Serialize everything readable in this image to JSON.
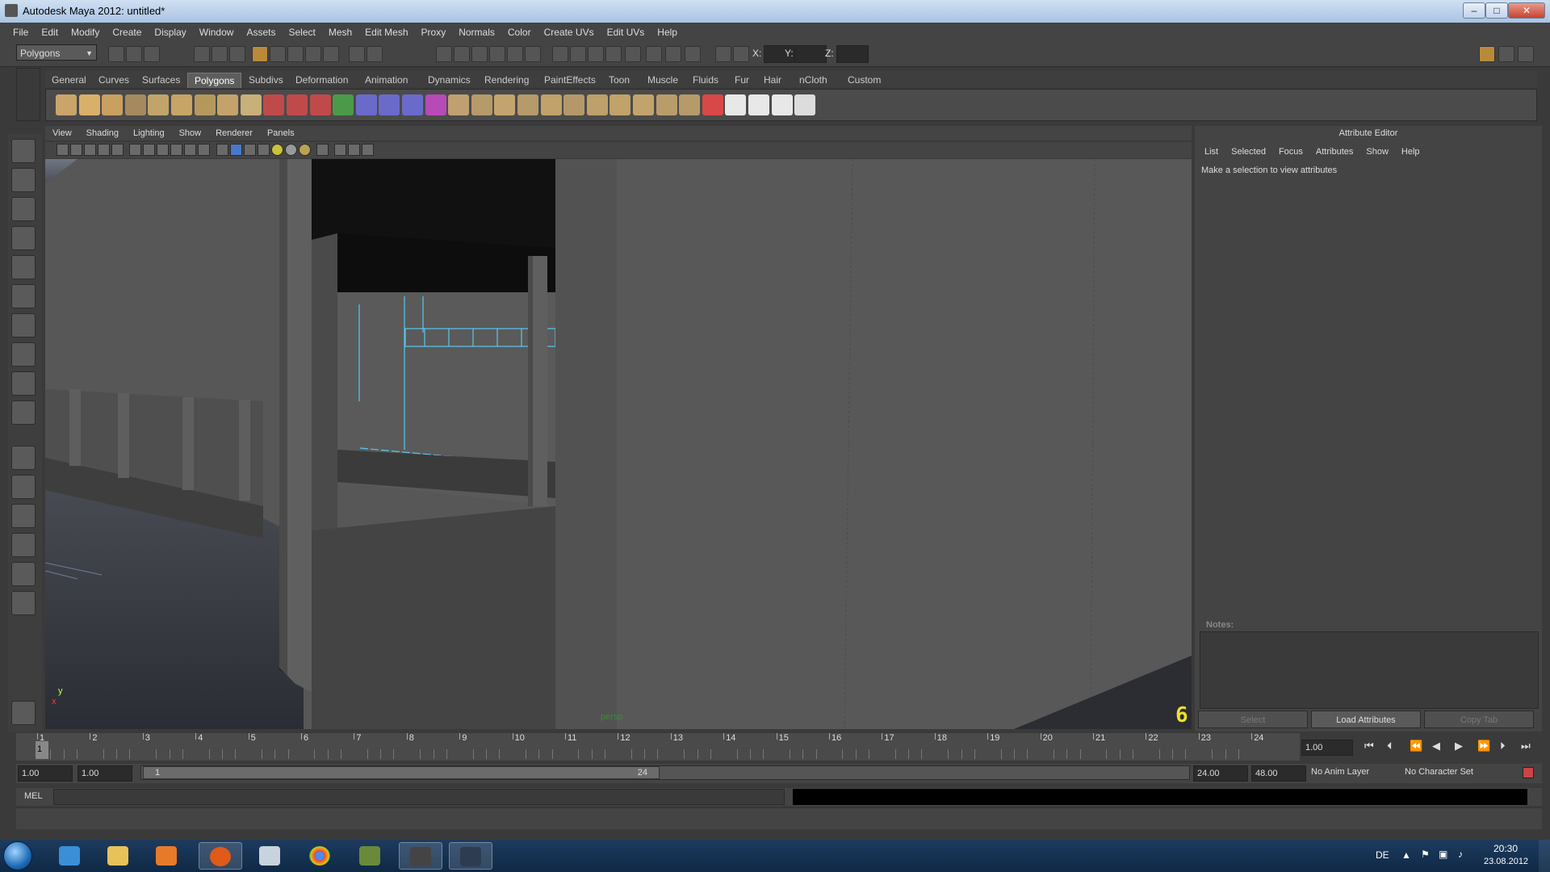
{
  "window": {
    "title": "Autodesk Maya 2012: untitled*",
    "buttons": {
      "minimize": "–",
      "maximize": "□",
      "close": "✕"
    }
  },
  "menubar": [
    "File",
    "Edit",
    "Modify",
    "Create",
    "Display",
    "Window",
    "Assets",
    "Select",
    "Mesh",
    "Edit Mesh",
    "Proxy",
    "Normals",
    "Color",
    "Create UVs",
    "Edit UVs",
    "Help"
  ],
  "statusline": {
    "mode": "Polygons",
    "coord_labels": {
      "x": "X:",
      "y": "Y:",
      "z": "Z:"
    }
  },
  "shelf": {
    "tabs": [
      "General",
      "Curves",
      "Surfaces",
      "Polygons",
      "Subdivs",
      "Deformation",
      "Animation",
      "Dynamics",
      "Rendering",
      "PaintEffects",
      "Toon",
      "Muscle",
      "Fluids",
      "Fur",
      "Hair",
      "nCloth",
      "Custom"
    ],
    "active_tab": "Polygons",
    "icons": [
      "poly-sphere-icon",
      "poly-cube-icon",
      "poly-cylinder-icon",
      "poly-cone-icon",
      "poly-plane-icon",
      "poly-torus-icon",
      "poly-prism-icon",
      "poly-pipe-icon",
      "poly-soccerball-icon",
      "combine-icon",
      "separate-icon",
      "extract-icon",
      "smooth-icon",
      "bool-union-icon",
      "bool-difference-icon",
      "bool-intersection-icon",
      "mirror-icon",
      "average-vertices-icon",
      "fill-hole-icon",
      "triangulate-icon",
      "quadrangulate-icon",
      "extrude-icon",
      "bridge-icon",
      "append-polygon-icon",
      "split-polygon-icon",
      "insert-edgeloop-icon",
      "offset-edgeloop-icon",
      "sculpt-icon",
      "planar-mapping-icon",
      "cylindrical-mapping-icon",
      "spherical-mapping-icon",
      "automatic-mapping-icon",
      "uv-editor-icon"
    ]
  },
  "panel": {
    "menus": [
      "View",
      "Shading",
      "Lighting",
      "Show",
      "Renderer",
      "Panels"
    ],
    "camera_label": "persp",
    "frame_number": "6",
    "axis_y": "y",
    "axis_x": "x"
  },
  "attribute_editor": {
    "title": "Attribute Editor",
    "menus": [
      "List",
      "Selected",
      "Focus",
      "Attributes",
      "Show",
      "Help"
    ],
    "message": "Make a selection to view attributes",
    "notes_label": "Notes:",
    "buttons": {
      "select": "Select",
      "load": "Load Attributes",
      "copy": "Copy Tab"
    }
  },
  "timeline": {
    "ticks": [
      "1",
      "2",
      "3",
      "4",
      "5",
      "6",
      "7",
      "8",
      "9",
      "10",
      "11",
      "12",
      "13",
      "14",
      "15",
      "16",
      "17",
      "18",
      "19",
      "20",
      "21",
      "22",
      "23",
      "24"
    ],
    "current_frame_field": "1.00",
    "current_marker": "1"
  },
  "range": {
    "start_time": "1.00",
    "playback_start": "1.00",
    "range_start_label": "1",
    "range_end_label": "24",
    "playback_end": "24.00",
    "end_time": "48.00",
    "anim_layer": "No Anim Layer",
    "character_set": "No Character Set"
  },
  "command_line": {
    "label": "MEL"
  },
  "taskbar": {
    "language": "DE",
    "time": "20:30",
    "date": "23.08.2012",
    "apps": [
      "internet-explorer-icon",
      "file-explorer-icon",
      "media-player-icon",
      "firefox-icon",
      "calculator-icon",
      "chrome-icon",
      "tractor-game-icon",
      "maya-icon",
      "maya-tray-icon"
    ]
  }
}
